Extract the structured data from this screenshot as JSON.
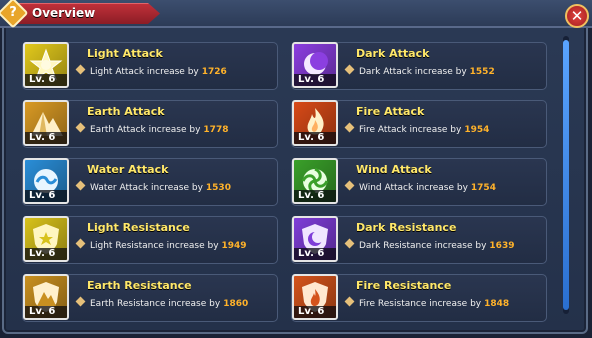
{
  "window": {
    "title": "Overview",
    "help_glyph": "?",
    "close_glyph": "✕"
  },
  "level_prefix": "Lv.",
  "stats": [
    {
      "name": "Light Attack",
      "desc": "Light Attack increase by",
      "value": "1726",
      "level": "6",
      "color": "#e2c91c",
      "icon": "sun-star-icon"
    },
    {
      "name": "Dark Attack",
      "desc": "Dark Attack increase by",
      "value": "1552",
      "level": "6",
      "color": "#8b3fe0",
      "icon": "crescent-moon-icon"
    },
    {
      "name": "Earth Attack",
      "desc": "Earth Attack increase by",
      "value": "1778",
      "level": "6",
      "color": "#d99a24",
      "icon": "mountain-icon"
    },
    {
      "name": "Fire Attack",
      "desc": "Fire Attack increase by",
      "value": "1954",
      "level": "6",
      "color": "#d84a18",
      "icon": "flame-icon"
    },
    {
      "name": "Water Attack",
      "desc": "Water Attack increase by",
      "value": "1530",
      "level": "6",
      "color": "#2a8ed8",
      "icon": "water-wave-icon"
    },
    {
      "name": "Wind Attack",
      "desc": "Wind Attack increase by",
      "value": "1754",
      "level": "6",
      "color": "#3aa02a",
      "icon": "wind-swirl-icon"
    },
    {
      "name": "Light Resistance",
      "desc": "Light Resistance increase by",
      "value": "1949",
      "level": "6",
      "color": "#d8c21c",
      "icon": "light-shield-icon"
    },
    {
      "name": "Dark Resistance",
      "desc": "Dark Resistance increase by",
      "value": "1639",
      "level": "6",
      "color": "#7f3ed8",
      "icon": "dark-shield-icon"
    },
    {
      "name": "Earth Resistance",
      "desc": "Earth Resistance increase by",
      "value": "1860",
      "level": "6",
      "color": "#c99020",
      "icon": "earth-shield-icon"
    },
    {
      "name": "Fire Resistance",
      "desc": "Fire Resistance increase by",
      "value": "1848",
      "level": "6",
      "color": "#d4541c",
      "icon": "fire-shield-icon"
    }
  ]
}
